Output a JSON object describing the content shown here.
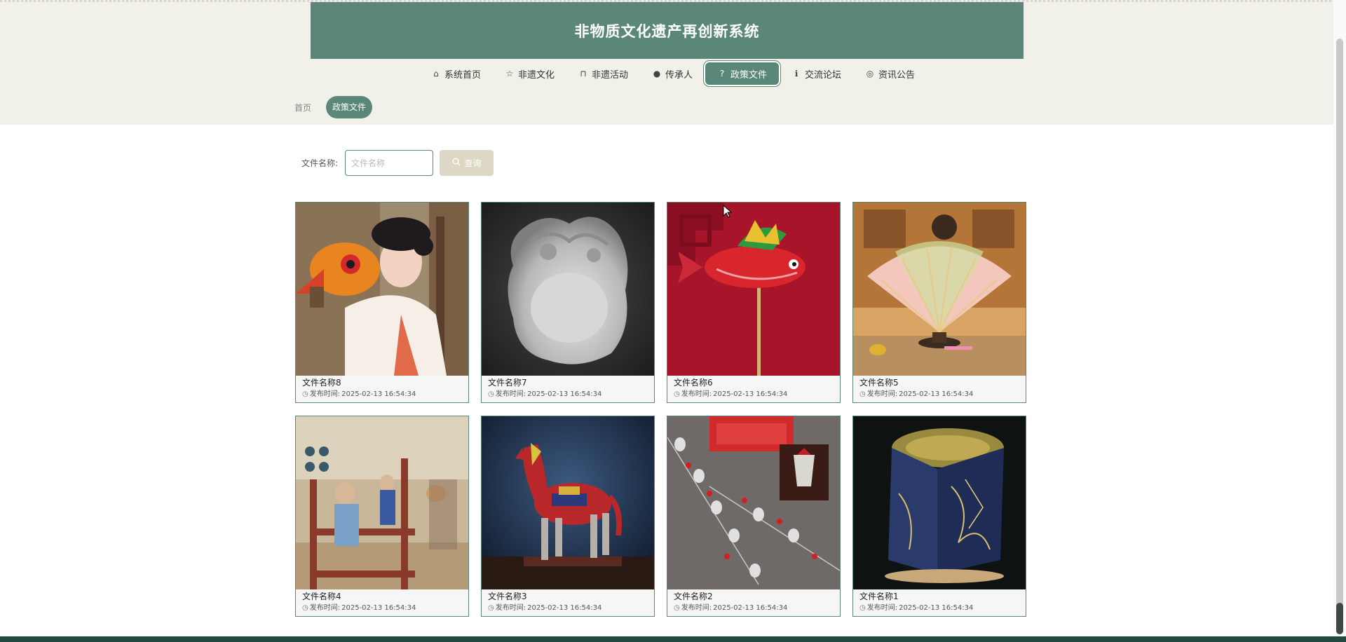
{
  "header": {
    "title": "非物质文化遗产再创新系统"
  },
  "nav": [
    {
      "label": "系统首页",
      "icon": "home-icon",
      "glyph": "⌂",
      "active": false
    },
    {
      "label": "非遗文化",
      "icon": "star-icon",
      "glyph": "☆",
      "active": false
    },
    {
      "label": "非遗活动",
      "icon": "bag-icon",
      "glyph": "⊓",
      "active": false
    },
    {
      "label": "传承人",
      "icon": "info-icon",
      "glyph": "●",
      "active": false
    },
    {
      "label": "政策文件",
      "icon": "question-icon",
      "glyph": "?",
      "active": true
    },
    {
      "label": "交流论坛",
      "icon": "info-circle-icon",
      "glyph": "ℹ",
      "active": false
    },
    {
      "label": "资讯公告",
      "icon": "globe-icon",
      "glyph": "◎",
      "active": false
    }
  ],
  "breadcrumb": {
    "home": "首页",
    "current": "政策文件"
  },
  "search": {
    "label": "文件名称:",
    "placeholder": "文件名称",
    "value": "",
    "button_label": "查询"
  },
  "cards": [
    {
      "title": "文件名称8",
      "time_label": "发布时间:",
      "time": "2025-02-13 16:54:34",
      "image": "woman-with-fish-lantern"
    },
    {
      "title": "文件名称7",
      "time_label": "发布时间:",
      "time": "2025-02-13 16:54:34",
      "image": "carved-jade-plaque"
    },
    {
      "title": "文件名称6",
      "time_label": "发布时间:",
      "time": "2025-02-13 16:54:34",
      "image": "red-fish-lantern"
    },
    {
      "title": "文件名称5",
      "time_label": "发布时间:",
      "time": "2025-02-13 16:54:34",
      "image": "folding-fan"
    },
    {
      "title": "文件名称4",
      "time_label": "发布时间:",
      "time": "2025-02-13 16:54:34",
      "image": "wooden-loom-workshop"
    },
    {
      "title": "文件名称3",
      "time_label": "发布时间:",
      "time": "2025-02-13 16:54:34",
      "image": "tang-horse-figure"
    },
    {
      "title": "文件名称2",
      "time_label": "发布时间:",
      "time": "2025-02-13 16:54:34",
      "image": "opera-mask-ornaments"
    },
    {
      "title": "文件名称1",
      "time_label": "发布时间:",
      "time": "2025-02-13 16:54:34",
      "image": "paper-lamp"
    }
  ],
  "colors": {
    "accent": "#5a8778",
    "band": "#f1f0e9",
    "button": "#dcd8c5",
    "footer": "#22493f"
  }
}
